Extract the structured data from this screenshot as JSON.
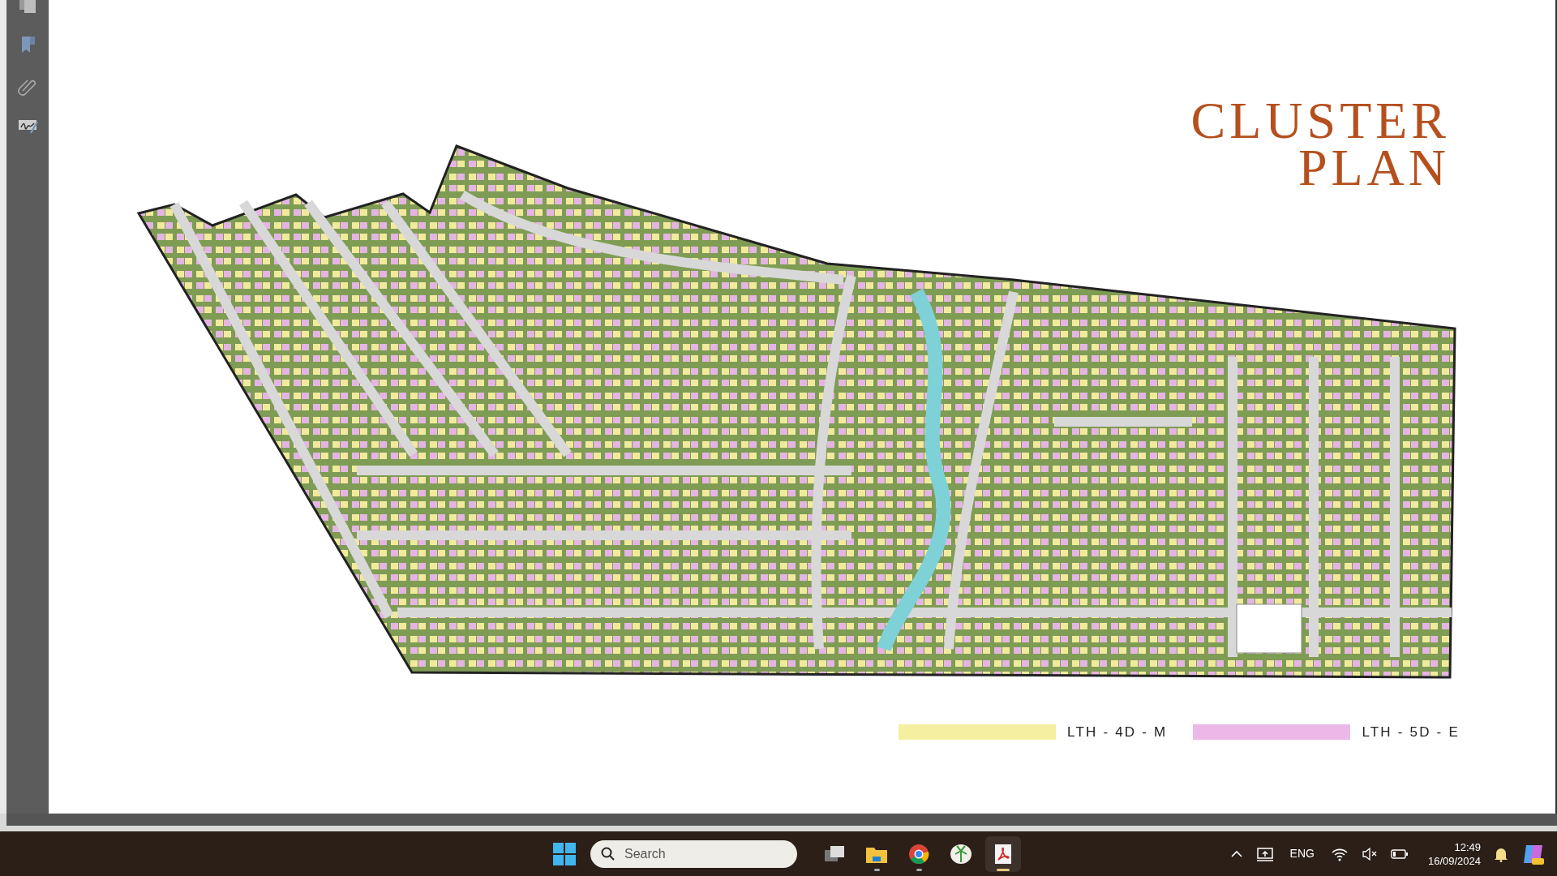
{
  "document": {
    "title_lines": [
      "CLUSTER",
      "PLAN"
    ],
    "legend": [
      {
        "label": "LTH - 4D - M",
        "color": "#f5efa0"
      },
      {
        "label": "LTH - 5D - E",
        "color": "#ebb8e8"
      }
    ]
  },
  "taskbar": {
    "search": {
      "placeholder": "Search"
    },
    "apps": [
      {
        "kind": "taskview",
        "running": false,
        "selected": false
      },
      {
        "kind": "folder",
        "running": true,
        "selected": false
      },
      {
        "kind": "browser",
        "running": true,
        "selected": false
      },
      {
        "kind": "palm",
        "running": false,
        "selected": false
      },
      {
        "kind": "pdf",
        "running": true,
        "selected": true
      }
    ],
    "language": "ENG",
    "time": "12:49",
    "date": "16/09/2024"
  }
}
